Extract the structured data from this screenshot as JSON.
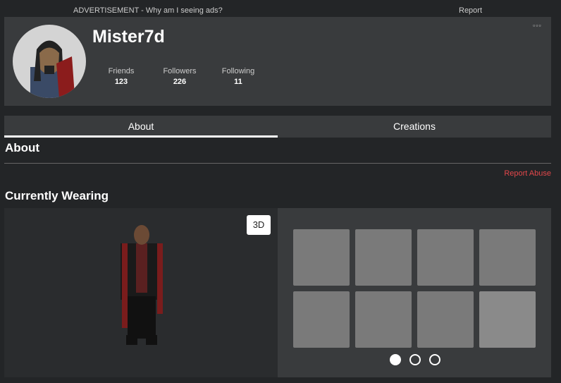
{
  "ad": {
    "text": "ADVERTISEMENT - Why am I seeing ads?",
    "report": "Report"
  },
  "profile": {
    "username": "Mister7d",
    "more": "▫▫▫",
    "stats": [
      {
        "label": "Friends",
        "value": "123"
      },
      {
        "label": "Followers",
        "value": "226"
      },
      {
        "label": "Following",
        "value": "11"
      }
    ]
  },
  "tabs": [
    {
      "label": "About"
    },
    {
      "label": "Creations"
    }
  ],
  "about": {
    "heading": "About",
    "report_abuse": "Report Abuse"
  },
  "wearing": {
    "heading": "Currently Wearing",
    "view_toggle": "3D",
    "page_count": 3,
    "active_page": 1
  }
}
